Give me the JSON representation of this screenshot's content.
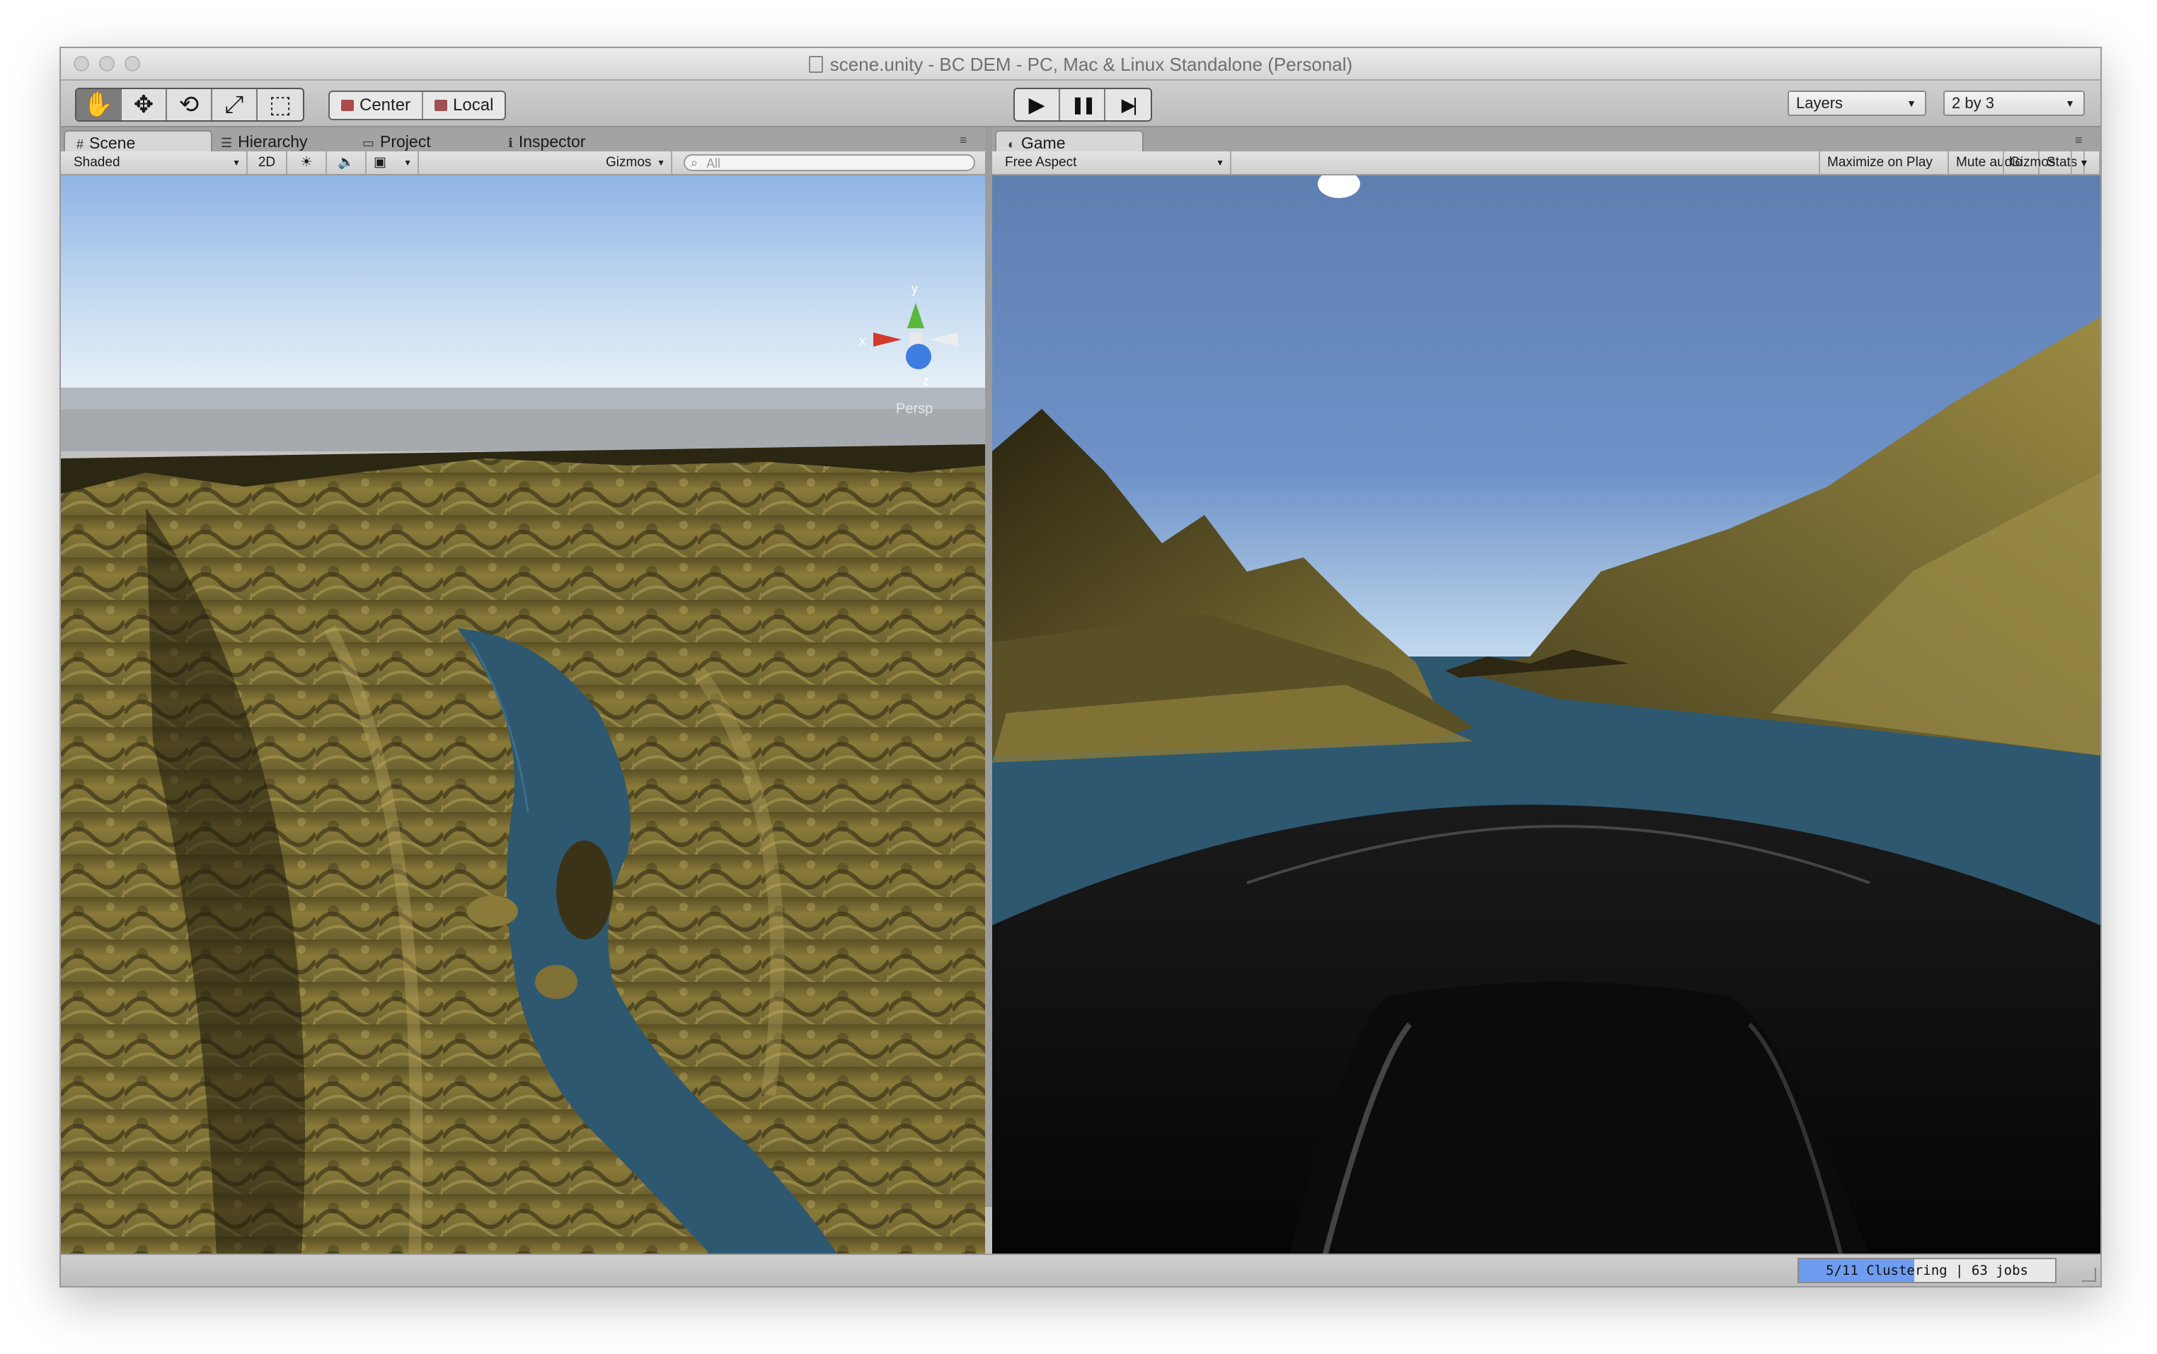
{
  "window": {
    "title": "scene.unity - BC DEM - PC, Mac & Linux Standalone (Personal)"
  },
  "toolbar": {
    "tools": [
      {
        "name": "hand-tool",
        "icon": "hand-icon",
        "glyph": "✋",
        "active": true
      },
      {
        "name": "move-tool",
        "icon": "move-icon",
        "glyph": "✥",
        "active": false
      },
      {
        "name": "rotate-tool",
        "icon": "rotate-icon",
        "glyph": "⟲",
        "active": false
      },
      {
        "name": "scale-tool",
        "icon": "scale-icon",
        "glyph": "⤢",
        "active": false
      },
      {
        "name": "rect-tool",
        "icon": "rect-icon",
        "glyph": "⬚",
        "active": false
      }
    ],
    "pivot_label": "Center",
    "rotation_label": "Local",
    "play_glyph": "▶",
    "pause_glyph": "❚❚",
    "step_glyph": "▶|",
    "layers_label": "Layers",
    "layout_label": "2 by 3"
  },
  "scene_panel": {
    "tabs": [
      {
        "label": "Scene",
        "icon": "grid-icon",
        "glyph": "#",
        "active": true
      },
      {
        "label": "Hierarchy",
        "icon": "list-icon",
        "glyph": "☰",
        "active": false
      },
      {
        "label": "Project",
        "icon": "folder-icon",
        "glyph": "▭",
        "active": false
      },
      {
        "label": "Inspector",
        "icon": "info-icon",
        "glyph": "ℹ",
        "active": false
      }
    ],
    "shading_mode": "Shaded",
    "mode_2d": "2D",
    "gizmos_label": "Gizmos",
    "search_placeholder": "All",
    "gizmo_axes": {
      "y": "y",
      "x": "x",
      "z": "z"
    },
    "persp_label": "Persp"
  },
  "game_panel": {
    "tab_label": "Game",
    "aspect_label": "Free Aspect",
    "maximize_label": "Maximize on Play",
    "mute_label": "Mute audio",
    "stats_label": "Stats",
    "gizmos_label": "Gizmos"
  },
  "status": {
    "progress_text": "5/11 Clustering | 63 jobs",
    "progress_fraction": 0.45
  },
  "colors": {
    "terrain": "#8a7b3a",
    "water": "#2e5870",
    "sky_top": "#5e7fb0",
    "sky_horizon": "#d8e8f4",
    "progress_accent": "#6d9cf0"
  }
}
